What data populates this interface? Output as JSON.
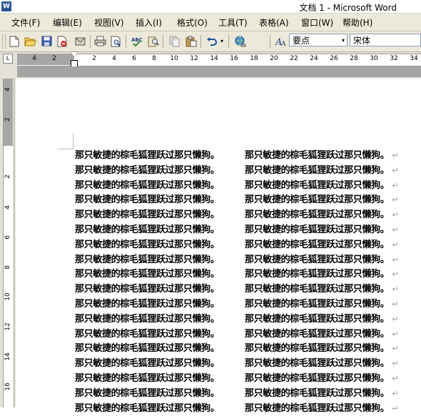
{
  "window": {
    "title": "文档 1 - Microsoft Word",
    "app_icon_letter": "W"
  },
  "menu": [
    {
      "label": "文件(F)",
      "name": "menu-file"
    },
    {
      "label": "编辑(E)",
      "name": "menu-edit"
    },
    {
      "label": "视图(V)",
      "name": "menu-view"
    },
    {
      "label": "插入(I)",
      "name": "menu-insert"
    },
    {
      "label": "格式(O)",
      "name": "menu-format"
    },
    {
      "label": "工具(T)",
      "name": "menu-tools"
    },
    {
      "label": "表格(A)",
      "name": "menu-table"
    },
    {
      "label": "窗口(W)",
      "name": "menu-window"
    },
    {
      "label": "帮助(H)",
      "name": "menu-help"
    }
  ],
  "toolbar": {
    "buttons": [
      "new-document-icon",
      "open-icon",
      "save-icon",
      "permission-icon",
      "email-icon",
      "print-icon",
      "print-preview-icon",
      "spelling-icon",
      "research-icon",
      "copy-icon",
      "paste-icon",
      "undo-icon",
      "undo-dropdown-icon",
      "insert-hyperlink-icon",
      "styles-icon"
    ],
    "style_value": "要点",
    "font_value": "宋体",
    "dropdown_arrow": "▾"
  },
  "ruler": {
    "tab_selector": "L",
    "horizontal_numbers": [
      "4",
      "2",
      "2",
      "4",
      "6",
      "8",
      "10",
      "12",
      "14",
      "16",
      "18",
      "20",
      "22",
      "24",
      "26",
      "28",
      "30",
      "32",
      "34"
    ],
    "vertical_numbers": [
      "4",
      "2",
      "2",
      "4",
      "6",
      "8",
      "10",
      "12",
      "14",
      "16"
    ]
  },
  "document": {
    "line_text": "那只敏捷的棕毛狐狸跃过那只懒狗。",
    "paragraph_mark": "↵",
    "line_count": 18
  },
  "colors": {
    "menu_bg": "#ece9d8",
    "ruler_gray": "#a6a6a6",
    "accent_blue": "#2b579a"
  }
}
